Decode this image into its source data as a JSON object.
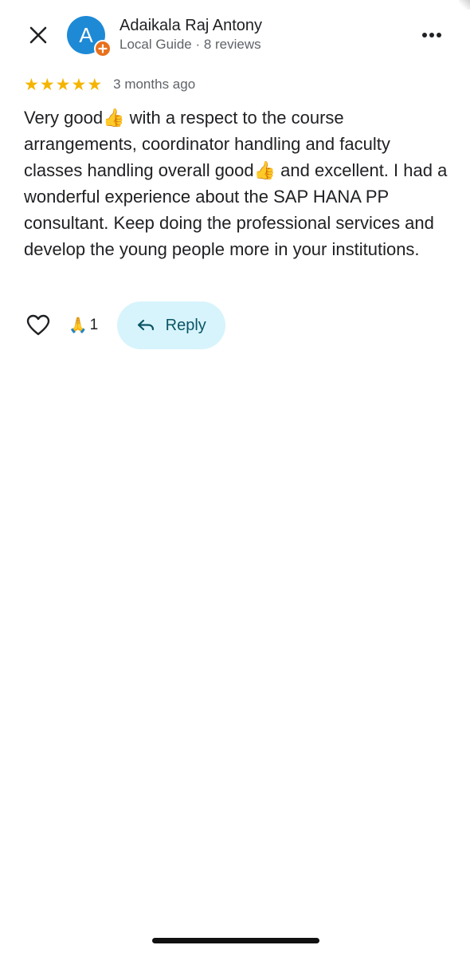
{
  "review": {
    "author": {
      "initial": "A",
      "name": "Adaikala Raj Antony",
      "meta": "Local Guide · 8 reviews",
      "avatar_color": "#1e8ad6",
      "badge_color": "#e8711c"
    },
    "rating": 5,
    "rating_max": 5,
    "age": "3 months ago",
    "text_parts": {
      "p1": "Very good",
      "p2": " with a respect to the course arrangements, coordinator handling and faculty classes handling overall good",
      "p3": " and excellent. I had a wonderful experience about the SAP HANA PP consultant. Keep doing the professional services and develop the young people more in your institutions."
    },
    "emoji": "👍",
    "reaction_emoji": "🙏",
    "reaction_count": "1",
    "reply_label": "Reply"
  },
  "icons": {
    "close": "close-icon",
    "more": "more-vert-icon",
    "like": "heart-outline-icon",
    "reply": "reply-arrow-icon",
    "badge": "local-guide-badge-icon"
  },
  "colors": {
    "star": "#f5b400",
    "reply_bg": "#d7f4fc",
    "reply_text": "#0b5565"
  }
}
